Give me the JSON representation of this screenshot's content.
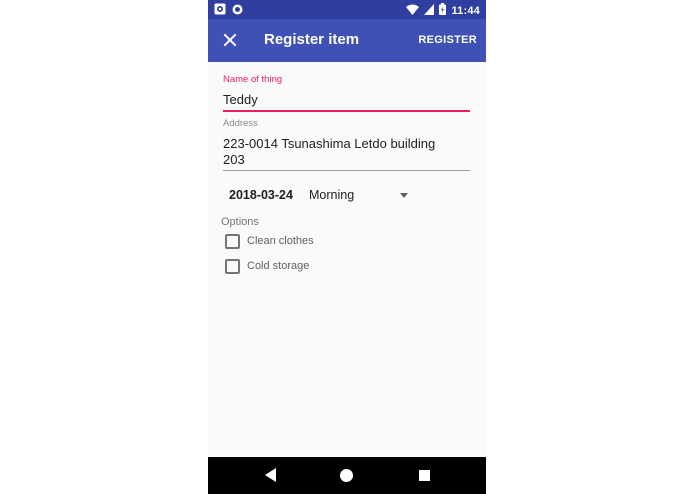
{
  "status_bar": {
    "time": "11:44",
    "left_icons": [
      "alarm-notification-icon",
      "sync-notification-icon"
    ],
    "right_icons": [
      "wifi-icon",
      "cell-signal-icon",
      "battery-icon"
    ]
  },
  "app_bar": {
    "title": "Register item",
    "action": "REGISTER",
    "close_icon": "close-icon"
  },
  "form": {
    "name": {
      "label": "Name of thing",
      "value": "Teddy"
    },
    "address": {
      "label": "Address",
      "value_line1": "223-0014 Tsunashima Letdo building",
      "value_line2": "203"
    },
    "date": "2018-03-24",
    "time_slot": "Morning",
    "options_label": "Options",
    "options": [
      {
        "label": "Clean clothes",
        "checked": false
      },
      {
        "label": "Cold storage",
        "checked": false
      }
    ]
  },
  "colors": {
    "primary": "#3f51b5",
    "primary_dark": "#303f9f",
    "accent": "#e91e63"
  }
}
